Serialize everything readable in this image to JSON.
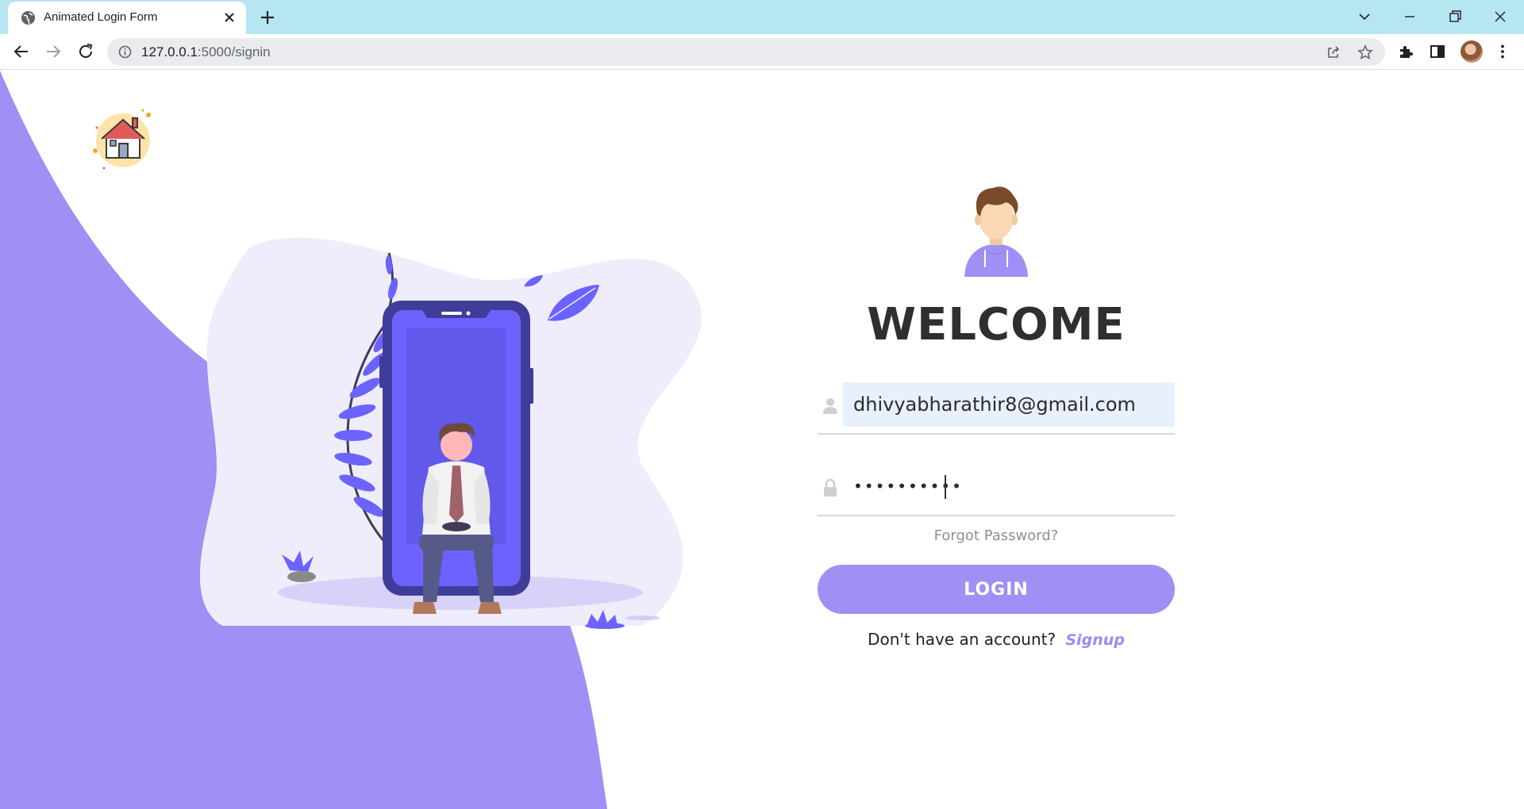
{
  "browser": {
    "tab_title": "Animated Login Form",
    "url_host": "127.0.0.1",
    "url_path": ":5000/signin",
    "icons": [
      "globe-icon",
      "close-icon",
      "plus-icon",
      "chevron-down-icon",
      "minimize-icon",
      "restore-icon",
      "close-window-icon",
      "back-icon",
      "forward-icon",
      "reload-icon",
      "info-icon",
      "share-icon",
      "star-icon",
      "extensions-icon",
      "side-panel-icon",
      "menu-dots-icon"
    ]
  },
  "page": {
    "colors": {
      "accent": "#a08ff5",
      "blob": "#efedfc",
      "dark_purple": "#3f3d99",
      "phone_screen": "#6c63ff",
      "text_dark": "#2f2f2f",
      "link": "#9b8cf2",
      "autofill": "#e8f0fe"
    },
    "logo_icon": "home-icon",
    "welcome": "WELCOME",
    "email": {
      "value": "dhivyabharathir8@gmail.com",
      "icon": "user-icon"
    },
    "password": {
      "value": "••••••••••",
      "icon": "lock-icon"
    },
    "forgot": "Forgot Password?",
    "login_label": "LOGIN",
    "no_account": "Don't have an account?",
    "signup": "Signup"
  }
}
